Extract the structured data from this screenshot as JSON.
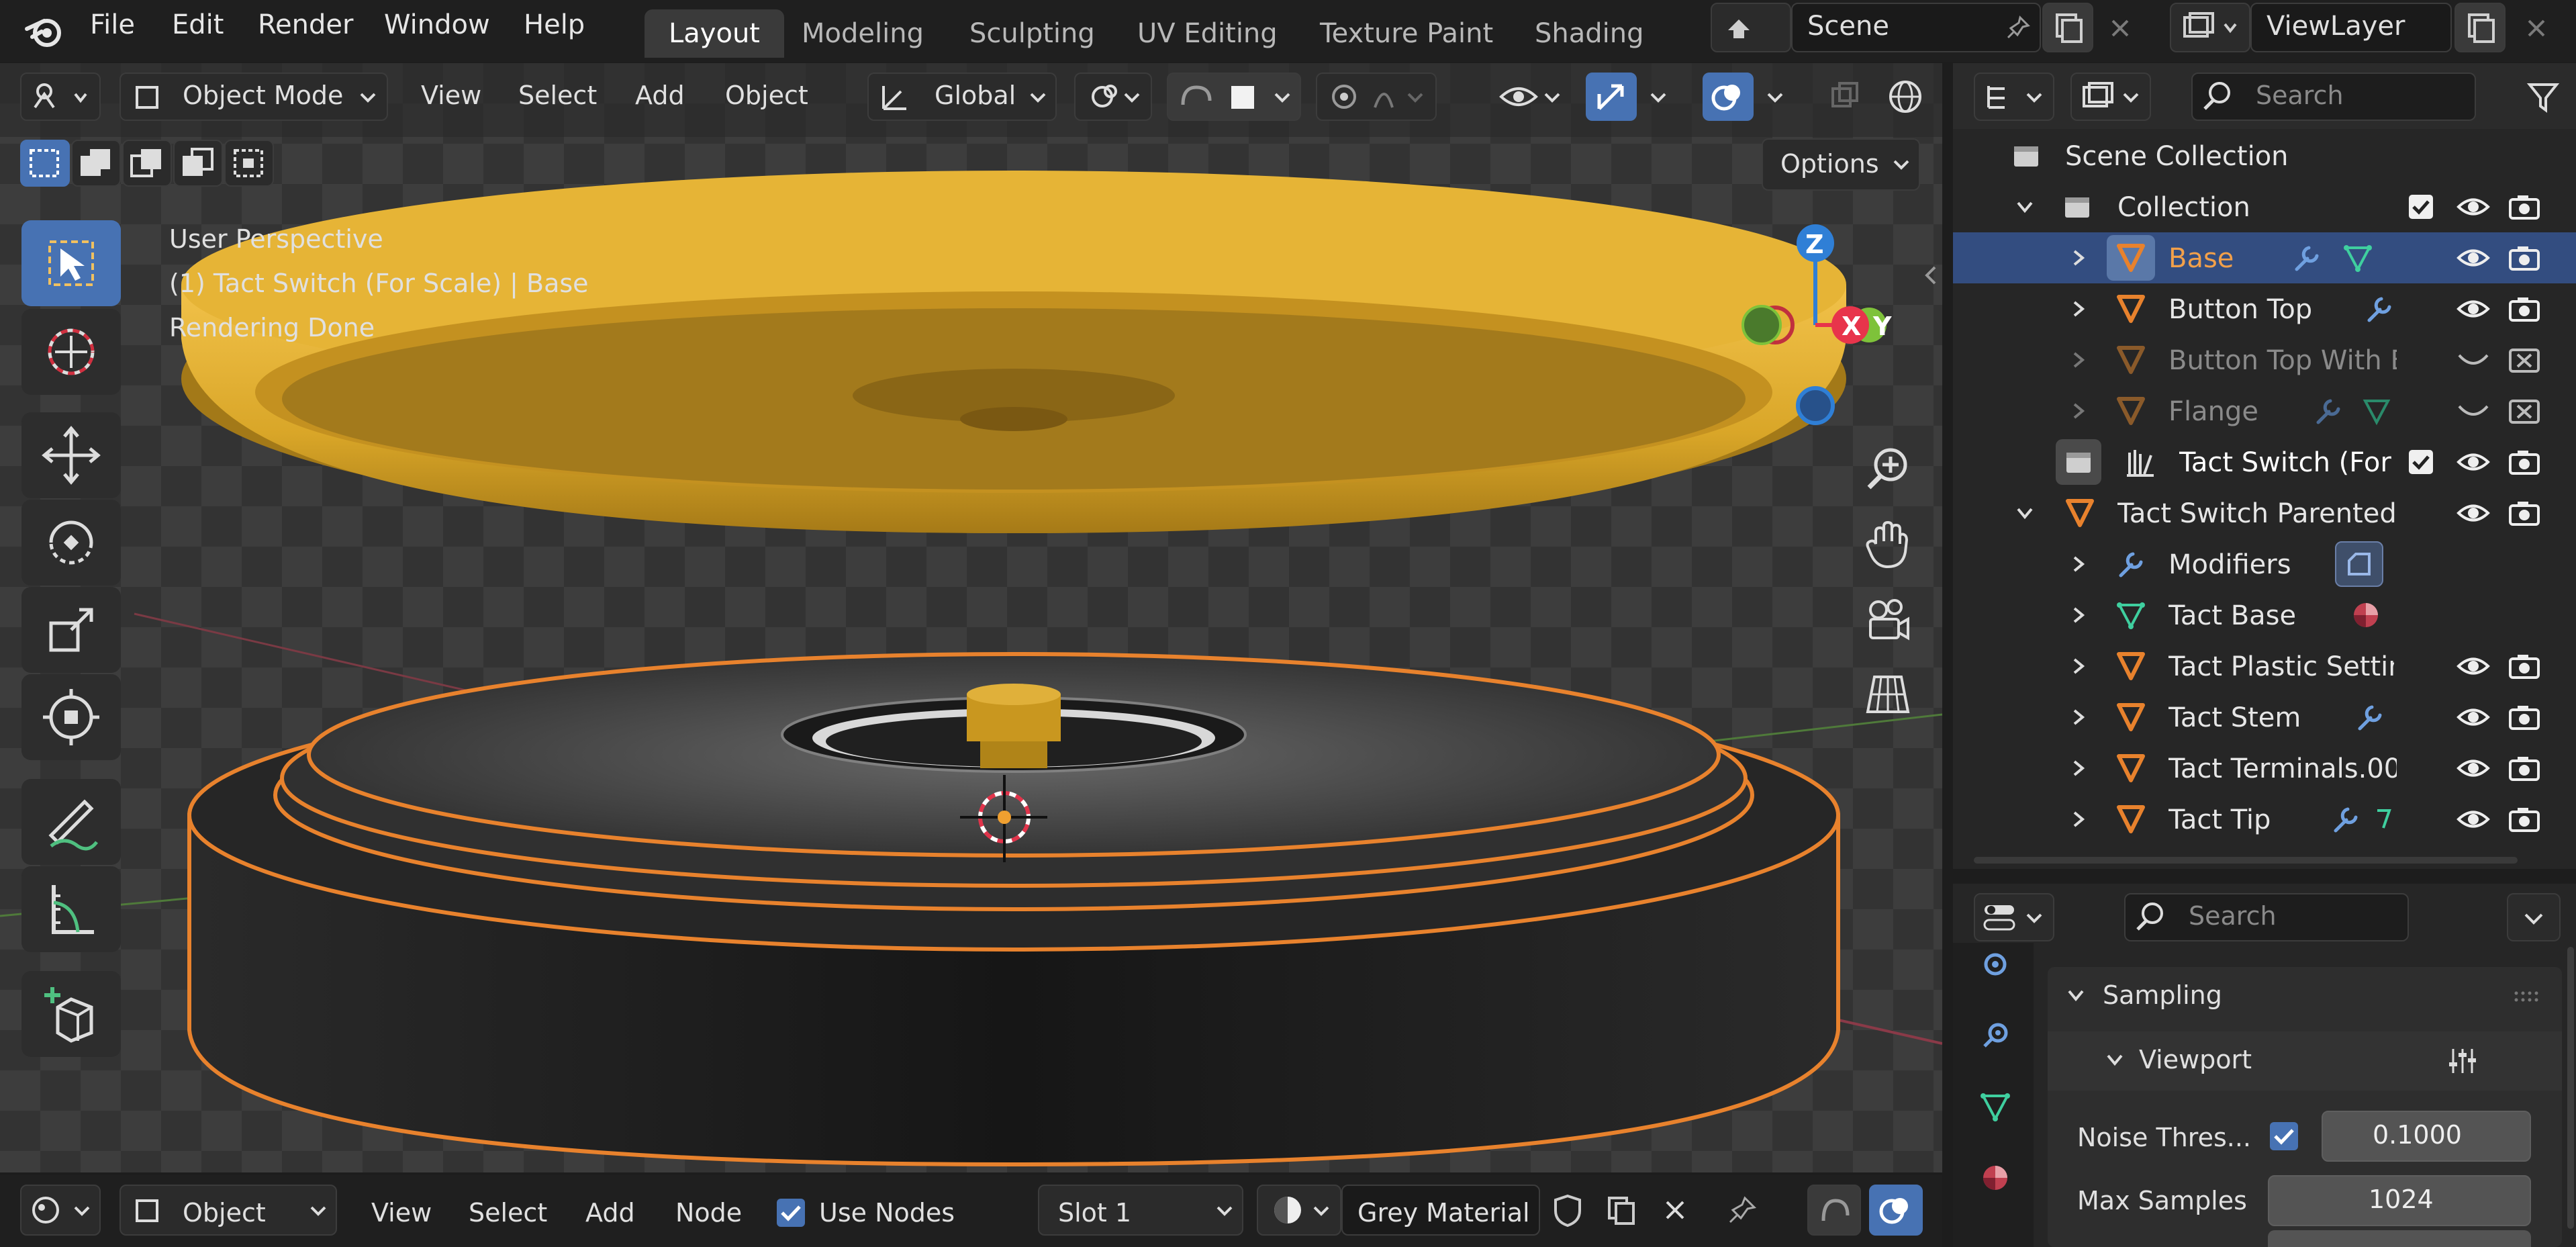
{
  "topbar": {
    "menus": [
      "File",
      "Edit",
      "Render",
      "Window",
      "Help"
    ],
    "workspace_tabs": [
      "Layout",
      "Modeling",
      "Sculpting",
      "UV Editing",
      "Texture Paint",
      "Shading"
    ],
    "active_tab": "Layout",
    "scene_name": "Scene",
    "view_layer": "ViewLayer"
  },
  "viewport_header": {
    "mode": "Object Mode",
    "menus": [
      "View",
      "Select",
      "Add",
      "Object"
    ],
    "orientation": "Global",
    "options_label": "Options"
  },
  "viewport_overlay": {
    "line1": "User Perspective",
    "line2": "(1)  Tact Switch (For Scale) | Base",
    "line3": "Rendering Done"
  },
  "gizmo": {
    "z": "Z",
    "x": "X",
    "y": "Y"
  },
  "outliner": {
    "search_placeholder": "Search",
    "rows": [
      {
        "label": "Scene Collection"
      },
      {
        "label": "Collection"
      },
      {
        "label": "Base"
      },
      {
        "label": "Button Top"
      },
      {
        "label": "Button Top With B"
      },
      {
        "label": "Flange"
      },
      {
        "label": "Tact Switch (For S"
      },
      {
        "label": "Tact Switch Parented I"
      },
      {
        "label": "Modifiers"
      },
      {
        "label": "Tact Base"
      },
      {
        "label": "Tact Plastic Settin"
      },
      {
        "label": "Tact Stem"
      },
      {
        "label": "Tact Terminals.00"
      },
      {
        "label": "Tact Tip"
      }
    ]
  },
  "properties": {
    "search_placeholder": "Search",
    "panel": "Sampling",
    "subpanel": "Viewport",
    "noise_label": "Noise Thres...",
    "noise_value": "0.1000",
    "max_samples_label": "Max Samples",
    "max_samples_value": "1024"
  },
  "bottom_bar": {
    "mode": "Object",
    "menus": [
      "View",
      "Select",
      "Add",
      "Node"
    ],
    "use_nodes_label": "Use Nodes",
    "slot": "Slot 1",
    "material": "Grey Material"
  },
  "colors": {
    "accent": "#4772b3",
    "selected_row": "#334d80",
    "object_orange": "#e8822d",
    "mesh_yellow": "#d9a628",
    "axis_x": "#e8344b",
    "axis_y": "#7ec23a",
    "axis_z": "#2f7fd6"
  }
}
